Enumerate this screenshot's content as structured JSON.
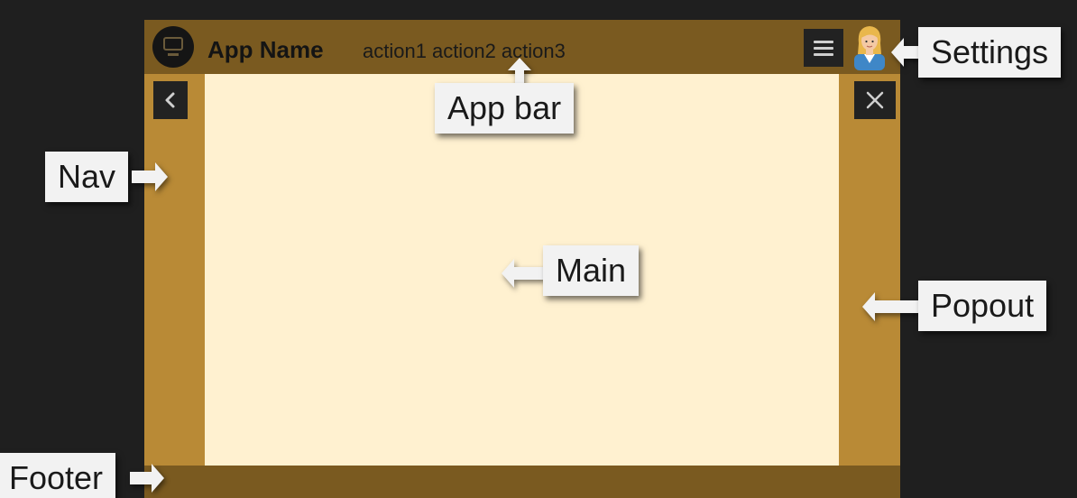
{
  "app": {
    "name": "App Name",
    "actions": [
      "action1",
      "action2",
      "action3"
    ]
  },
  "callouts": {
    "settings": "Settings",
    "app_bar": "App bar",
    "nav": "Nav",
    "main": "Main",
    "popout": "Popout",
    "footer": "Footer"
  },
  "icons": {
    "logo": "monitor-icon",
    "menu": "menu-icon",
    "avatar": "user-avatar-icon",
    "back": "chevron-left-icon",
    "close": "close-icon"
  },
  "colors": {
    "background": "#1f1f1f",
    "app_bar": "#7a5a20",
    "side_panels": "#b98a36",
    "main": "#fff1d0",
    "label_bg": "#f2f2f2"
  }
}
